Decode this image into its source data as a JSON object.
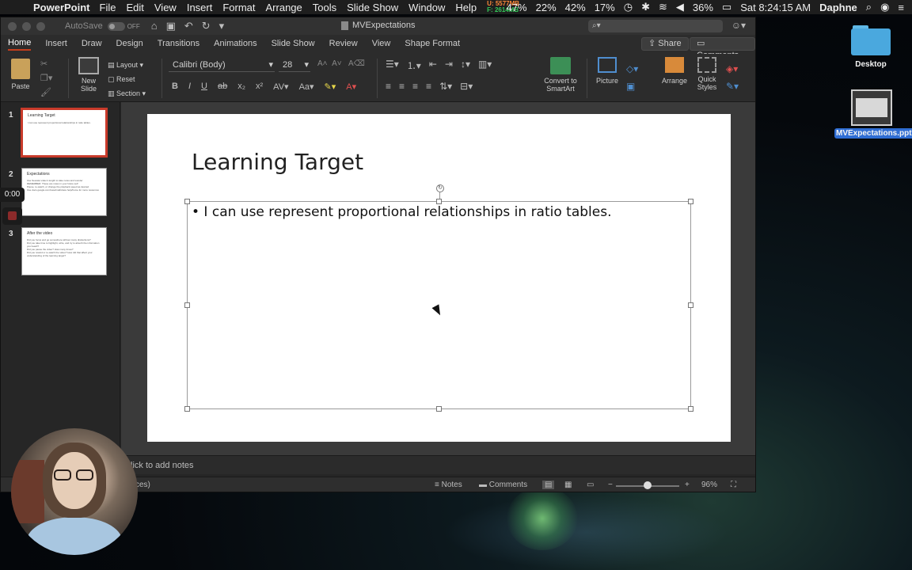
{
  "menubar": {
    "app_name": "PowerPoint",
    "menus": [
      "File",
      "Edit",
      "View",
      "Insert",
      "Format",
      "Arrange",
      "Tools",
      "Slide Show",
      "Window",
      "Help"
    ],
    "mem_used": "U: 5577MB",
    "mem_free": "F: 2614MB",
    "cpu": [
      "47%",
      "22%",
      "42%",
      "17%"
    ],
    "battery": "36%",
    "clock": "Sat 8:24:15 AM",
    "user": "Daphne"
  },
  "window": {
    "autosave_label": "AutoSave",
    "autosave_state": "OFF",
    "document_title": "MVExpectations",
    "tabs": [
      "Home",
      "Insert",
      "Draw",
      "Design",
      "Transitions",
      "Animations",
      "Slide Show",
      "Review",
      "View",
      "Shape Format"
    ],
    "active_tab": "Home",
    "share_label": "Share",
    "comments_label": "Comments"
  },
  "ribbon": {
    "paste": "Paste",
    "new_slide": "New Slide",
    "layout": "Layout",
    "reset": "Reset",
    "section": "Section",
    "font_name": "Calibri (Body)",
    "font_size": "28",
    "convert_smartart": "Convert to SmartArt",
    "picture": "Picture",
    "arrange": "Arrange",
    "quick_styles": "Quick Styles"
  },
  "thumbnails": [
    {
      "num": "1",
      "title": "Learning Target",
      "lines": [
        "I can use represent proportional relationships in ratio tables."
      ]
    },
    {
      "num": "2",
      "title": "Expectations",
      "lines": [
        "Use Seesaw video’s length to take notes and wonder",
        "REMEMBER: These are notes in your future self",
        "Pause, re-watch, or change the playback speed as desired",
        "Use docs.google.com/view/mathclass help/home for more resources"
      ]
    },
    {
      "num": "3",
      "title": "After the video",
      "lines": [
        "Did you focus and go somewhere without many distractions?",
        "Did you take time to highlight, write, and try to absorb the information you heard?",
        "Did you pause the video? How many times?",
        "Did you rewind or re-watch the video? How did that affect your understanding of the learning target?"
      ]
    }
  ],
  "slide": {
    "title": "Learning Target",
    "bullet": "• I can use represent proportional relationships in ratio tables."
  },
  "notes_placeholder": "lick to add notes",
  "statusbar": {
    "left_text": "ces)",
    "notes_label": "Notes",
    "comments_label": "Comments",
    "zoom": "96%"
  },
  "recording": {
    "timer": "0:00"
  },
  "desktop": {
    "folder_label": "Desktop",
    "file_label": "MVExpectations.pptx"
  }
}
